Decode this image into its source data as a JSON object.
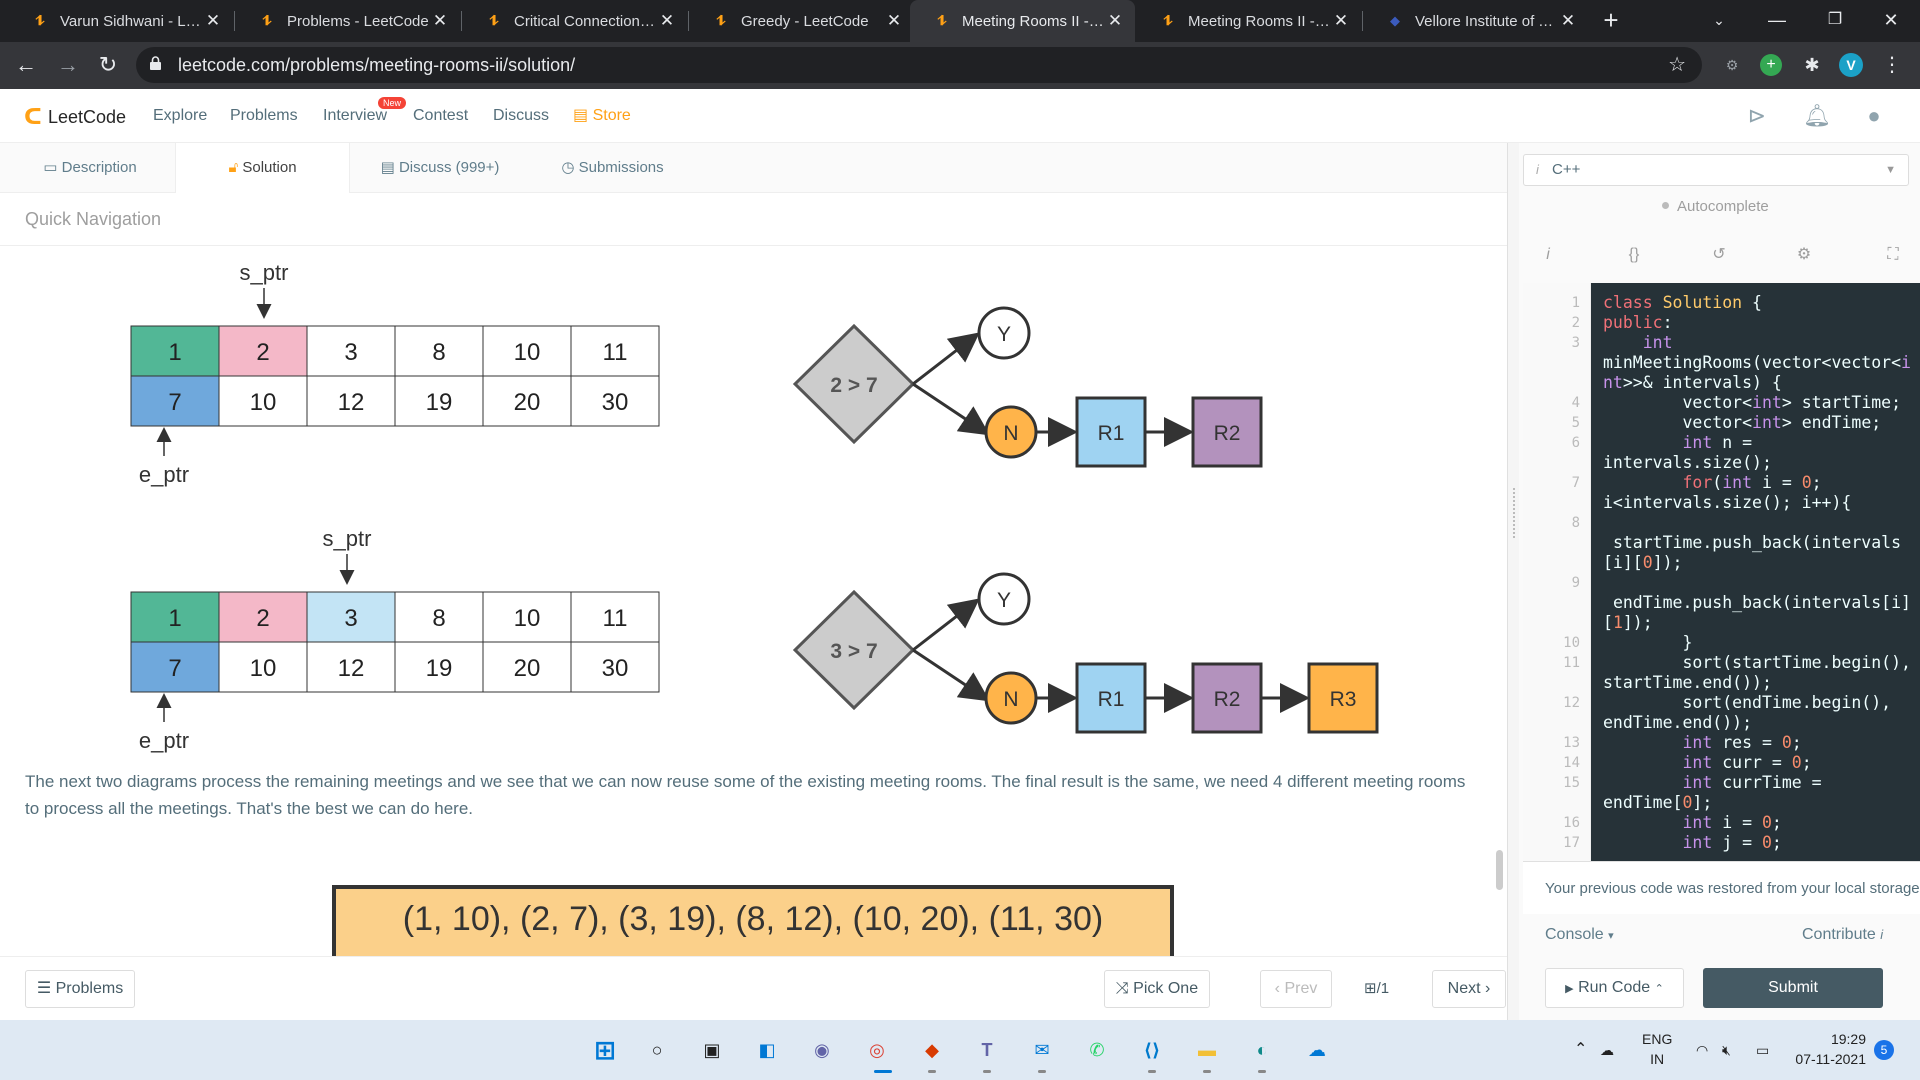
{
  "browser": {
    "tabs": [
      {
        "title": "Varun Sidhwani - Leet",
        "active": false
      },
      {
        "title": "Problems - LeetCode",
        "active": false
      },
      {
        "title": "Critical Connections in",
        "active": false
      },
      {
        "title": "Greedy - LeetCode",
        "active": false
      },
      {
        "title": "Meeting Rooms II - Le",
        "active": true
      },
      {
        "title": "Meeting Rooms II - Si",
        "active": false
      },
      {
        "title": "Vellore Institute of Tec",
        "active": false
      }
    ],
    "url": "leetcode.com/problems/meeting-rooms-ii/solution/",
    "profile_initial": "V"
  },
  "header": {
    "logo_text": "LeetCode",
    "nav": [
      "Explore",
      "Problems",
      "Interview",
      "Contest",
      "Discuss"
    ],
    "new_badge": "New",
    "store": "Store",
    "accent_color": "#ffa116"
  },
  "subtabs": [
    "Description",
    "Solution",
    "Discuss (999+)",
    "Submissions"
  ],
  "quick_nav": "Quick Navigation",
  "diagram1": {
    "s_ptr": "s_ptr",
    "e_ptr": "e_ptr",
    "top": [
      "1",
      "2",
      "3",
      "8",
      "10",
      "11"
    ],
    "bottom": [
      "7",
      "10",
      "12",
      "19",
      "20",
      "30"
    ],
    "decision": "2 > 7",
    "yes": "Y",
    "no": "N",
    "rooms": [
      "R1",
      "R2"
    ]
  },
  "diagram2": {
    "s_ptr": "s_ptr",
    "e_ptr": "e_ptr",
    "top": [
      "1",
      "2",
      "3",
      "8",
      "10",
      "11"
    ],
    "bottom": [
      "7",
      "10",
      "12",
      "19",
      "20",
      "30"
    ],
    "decision": "3 > 7",
    "yes": "Y",
    "no": "N",
    "rooms": [
      "R1",
      "R2",
      "R3"
    ]
  },
  "paragraph": "The next two diagrams process the remaining meetings and we see that we can now reuse some of the existing meeting rooms. The final result is the same, we need 4 different meeting rooms to process all the meetings. That's the best we can do here.",
  "intervals_banner": "(1, 10),  (2, 7),   (3, 19),  (8, 12),  (10, 20),  (11, 30)",
  "pager": {
    "problems": "Problems",
    "pick_one": "Pick One",
    "prev": "Prev",
    "page": "/1",
    "next": "Next"
  },
  "editor": {
    "language": "C++",
    "autocomplete": "Autocomplete",
    "line_numbers": [
      "1",
      "2",
      "3",
      "4",
      "5",
      "6",
      "7",
      "8",
      "9",
      "10",
      "11",
      "12",
      "13",
      "14",
      "15",
      "16",
      "17"
    ],
    "restore_msg": "Your previous code was restored from your local storage.",
    "console": "Console",
    "contribute": "Contribute",
    "run_code": "Run Code",
    "submit": "Submit"
  },
  "taskbar": {
    "lang": "ENG",
    "region": "IN",
    "time": "19:29",
    "date": "07-11-2021",
    "notifications": "5"
  }
}
